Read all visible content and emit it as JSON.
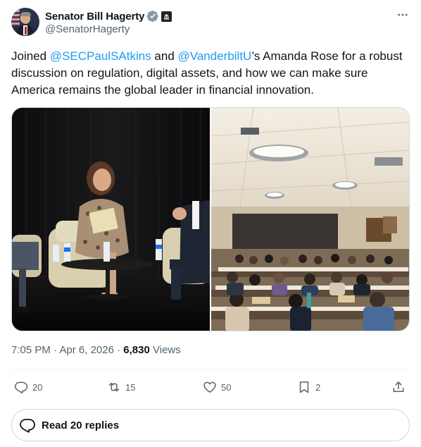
{
  "author": {
    "name": "Senator Bill Hagerty",
    "handle": "@SenatorHagerty"
  },
  "tweet": {
    "segments": [
      {
        "type": "text",
        "value": "Joined "
      },
      {
        "type": "mention",
        "value": "@SECPaulSAtkins"
      },
      {
        "type": "text",
        "value": " and "
      },
      {
        "type": "mention",
        "value": "@VanderbiltU"
      },
      {
        "type": "text",
        "value": "’s Amanda Rose for a robust discussion on regulation, digital assets, and how we can make sure America remains the global leader in financial innovation."
      }
    ]
  },
  "meta": {
    "time": "7:05 PM",
    "dot": "·",
    "date": "Apr 6, 2026",
    "views_count": "6,830",
    "views_label": "Views"
  },
  "actions": {
    "replies": "20",
    "reposts": "15",
    "likes": "50",
    "bookmarks": "2"
  },
  "read_replies_label": "Read 20 replies",
  "colors": {
    "accent": "#1d9bf0",
    "text": "#0f1419",
    "secondary": "#536471",
    "border": "#cfd9de",
    "divider": "#eff3f4"
  },
  "icons": [
    "verified-badge-icon",
    "government-badge-icon",
    "more-options-icon",
    "reply-icon",
    "repost-icon",
    "like-icon",
    "bookmark-icon",
    "share-icon",
    "replies-bubble-icon"
  ]
}
